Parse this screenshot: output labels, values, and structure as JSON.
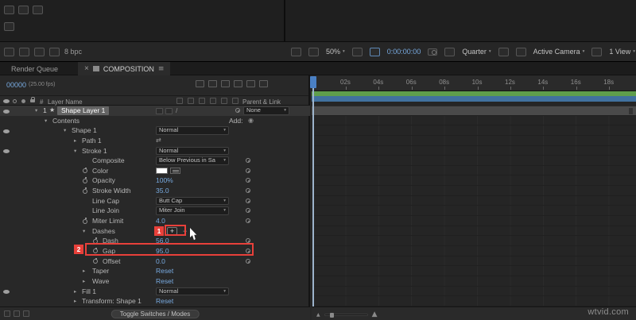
{
  "app": {
    "watermark": "wtvid.com"
  },
  "colors": {
    "accent_blue": "#78aae0",
    "annotation_red": "#e8403a",
    "render_bar_green": "#5f9e4c",
    "work_bar_blue": "#41719f"
  },
  "project_panel": {
    "bit_depth": "8 bpc"
  },
  "viewer": {
    "zoom": "50%",
    "timecode": "0:00:00:00",
    "resolution": "Quarter",
    "camera_view": "Active Camera",
    "view_layout": "1 View"
  },
  "timeline": {
    "tabs": [
      {
        "label": "Render Queue"
      },
      {
        "label": "COMPOSITION"
      }
    ],
    "timecode": "00000",
    "fps": "(25.00 fps)",
    "columns": {
      "hash": "#",
      "layer_name": "Layer Name",
      "parent_link": "Parent & Link"
    },
    "layer": {
      "index": "1",
      "name": "Shape Layer 1",
      "parent": "None"
    },
    "rows": [
      {
        "label": "Contents",
        "level": 1,
        "twirl": "open",
        "vtype": "add",
        "value": "Add:"
      },
      {
        "label": "Shape 1",
        "level": 2,
        "twirl": "open",
        "eye": true,
        "vtype": "dropdown",
        "value": "Normal"
      },
      {
        "label": "Path 1",
        "level": 3,
        "twirl": "closed",
        "vtype": "path",
        "value": ""
      },
      {
        "label": "Stroke 1",
        "level": 3,
        "twirl": "open",
        "eye": true,
        "vtype": "dropdown",
        "value": "Normal"
      },
      {
        "label": "Composite",
        "level": 4,
        "vtype": "dropdown",
        "value": "Below Previous in Sa",
        "link": true
      },
      {
        "label": "Color",
        "level": 4,
        "sw": true,
        "vtype": "swatch",
        "value": "",
        "link": true
      },
      {
        "label": "Opacity",
        "level": 4,
        "sw": true,
        "vtype": "num",
        "value": "100%",
        "link": true
      },
      {
        "label": "Stroke Width",
        "level": 4,
        "sw": true,
        "vtype": "num",
        "value": "35.0",
        "link": true
      },
      {
        "label": "Line Cap",
        "level": 4,
        "vtype": "dropdown",
        "value": "Butt Cap",
        "link": true
      },
      {
        "label": "Line Join",
        "level": 4,
        "vtype": "dropdown",
        "value": "Miter Join",
        "link": true
      },
      {
        "label": "Miter Limit",
        "level": 4,
        "sw": true,
        "vtype": "num",
        "value": "4.0",
        "link": true
      },
      {
        "label": "Dashes",
        "level": 4,
        "twirl": "open",
        "vtype": "plus",
        "value": "+"
      },
      {
        "label": "Dash",
        "level": 5,
        "sw": true,
        "vtype": "num",
        "value": "56.0",
        "link": true
      },
      {
        "label": "Gap",
        "level": 5,
        "sw": true,
        "vtype": "num",
        "value": "95.0",
        "link": true
      },
      {
        "label": "Offset",
        "level": 5,
        "sw": true,
        "vtype": "num",
        "value": "0.0",
        "link": true
      },
      {
        "label": "Taper",
        "level": 4,
        "twirl": "closed",
        "vtype": "num",
        "value": "Reset"
      },
      {
        "label": "Wave",
        "level": 4,
        "twirl": "closed",
        "vtype": "num",
        "value": "Reset"
      },
      {
        "label": "Fill 1",
        "level": 3,
        "twirl": "closed",
        "eye": true,
        "vtype": "dropdown",
        "value": "Normal"
      },
      {
        "label": "Transform: Shape 1",
        "level": 3,
        "twirl": "closed",
        "vtype": "num",
        "value": "Reset"
      }
    ],
    "ruler_labels": [
      "02s",
      "04s",
      "06s",
      "08s",
      "10s",
      "12s",
      "14s",
      "16s",
      "18s"
    ],
    "toggle_bar": "Toggle Switches / Modes"
  },
  "annotations": {
    "step1": "1",
    "step2": "2"
  }
}
